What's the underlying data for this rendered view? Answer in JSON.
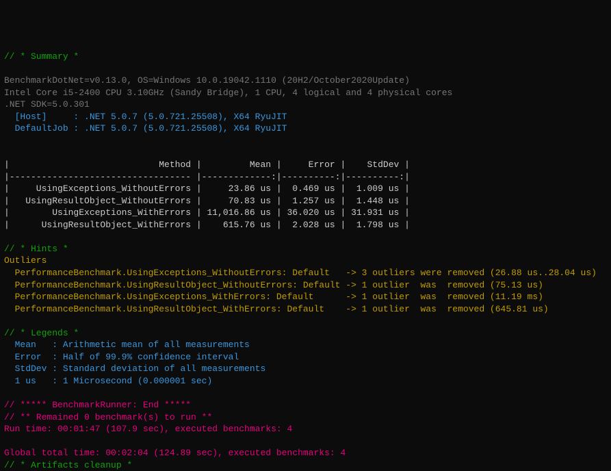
{
  "sections": {
    "summary_header": "// * Summary *",
    "env_line1": "BenchmarkDotNet=v0.13.0, OS=Windows 10.0.19042.1110 (20H2/October2020Update)",
    "env_line2": "Intel Core i5-2400 CPU 3.10GHz (Sandy Bridge), 1 CPU, 4 logical and 4 physical cores",
    "env_line3": ".NET SDK=5.0.301",
    "env_line4": "  [Host]     : .NET 5.0.7 (5.0.721.25508), X64 RyuJIT",
    "env_line5": "  DefaultJob : .NET 5.0.7 (5.0.721.25508), X64 RyuJIT",
    "table_header": "|                            Method |         Mean |     Error |    StdDev |",
    "table_divider": "|---------------------------------- |-------------:|----------:|----------:|",
    "table_row1": "|     UsingExceptions_WithoutErrors |     23.86 us |  0.469 us |  1.009 us |",
    "table_row2": "|   UsingResultObject_WithoutErrors |     70.83 us |  1.257 us |  1.448 us |",
    "table_row3": "|        UsingExceptions_WithErrors | 11,016.86 us | 36.020 us | 31.931 us |",
    "table_row4": "|      UsingResultObject_WithErrors |    615.76 us |  2.028 us |  1.798 us |",
    "hints_header": "// * Hints *",
    "outliers_label": "Outliers",
    "outlier1": "  PerformanceBenchmark.UsingExceptions_WithoutErrors: Default   -> 3 outliers were removed (26.88 us..28.04 us)",
    "outlier2": "  PerformanceBenchmark.UsingResultObject_WithoutErrors: Default -> 1 outlier  was  removed (75.13 us)",
    "outlier3": "  PerformanceBenchmark.UsingExceptions_WithErrors: Default      -> 1 outlier  was  removed (11.19 ms)",
    "outlier4": "  PerformanceBenchmark.UsingResultObject_WithErrors: Default    -> 1 outlier  was  removed (645.81 us)",
    "legends_header": "// * Legends *",
    "legend1": "  Mean   : Arithmetic mean of all measurements",
    "legend2": "  Error  : Half of 99.9% confidence interval",
    "legend3": "  StdDev : Standard deviation of all measurements",
    "legend4": "  1 us   : 1 Microsecond (0.000001 sec)",
    "runner_end": "// ***** BenchmarkRunner: End *****",
    "remained": "// ** Remained 0 benchmark(s) to run **",
    "run_time": "Run time: 00:01:47 (107.9 sec), executed benchmarks: 4",
    "global_time": "Global total time: 00:02:04 (124.89 sec), executed benchmarks: 4",
    "artifacts": "// * Artifacts cleanup *"
  },
  "chart_data": {
    "type": "table",
    "columns": [
      "Method",
      "Mean",
      "Error",
      "StdDev"
    ],
    "rows": [
      {
        "Method": "UsingExceptions_WithoutErrors",
        "Mean": "23.86 us",
        "Error": "0.469 us",
        "StdDev": "1.009 us"
      },
      {
        "Method": "UsingResultObject_WithoutErrors",
        "Mean": "70.83 us",
        "Error": "1.257 us",
        "StdDev": "1.448 us"
      },
      {
        "Method": "UsingExceptions_WithErrors",
        "Mean": "11,016.86 us",
        "Error": "36.020 us",
        "StdDev": "31.931 us"
      },
      {
        "Method": "UsingResultObject_WithErrors",
        "Mean": "615.76 us",
        "Error": "2.028 us",
        "StdDev": "1.798 us"
      }
    ]
  }
}
